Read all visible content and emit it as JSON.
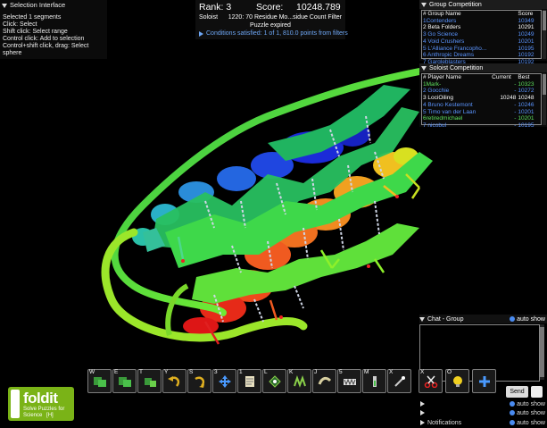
{
  "selection_panel": {
    "title": "Selection Interface",
    "lines": [
      "Selected 1 segments",
      "Click: Select",
      "Shift click: Select range",
      "Control click: Add to selection",
      "Control+shift click, drag: Select",
      "sphere"
    ]
  },
  "score": {
    "rank_label": "Rank: 3",
    "score_label": "Score:",
    "score_value": "10248.789",
    "mode": "Soloist",
    "puzzle": "1220: 70 Residue Mo...sidue Count Filter",
    "status": "Puzzle expired",
    "conditions": "Conditions satisfied: 1 of 1, 810.0 points from filters"
  },
  "group_competition": {
    "title": "Group Competition",
    "headers": [
      "# Group Name",
      "Score"
    ],
    "rows": [
      {
        "name": "1Contenders",
        "score": "10349"
      },
      {
        "name": "2 Beta Folders",
        "score": "10291"
      },
      {
        "name": "3 Go Science",
        "score": "10249"
      },
      {
        "name": "4 Void Crushers",
        "score": "10201"
      },
      {
        "name": "5 L'Alliance Francopho...",
        "score": "10195"
      },
      {
        "name": "6 Anthropic Dreams",
        "score": "10192"
      },
      {
        "name": "7 Gargleblasters",
        "score": "10192"
      }
    ]
  },
  "soloist_competition": {
    "title": "Soloist Competition",
    "headers": [
      "# Player Name",
      "Current",
      "Best"
    ],
    "rows": [
      {
        "name": "1Mark-",
        "current": "-",
        "best": "10323",
        "style": "green"
      },
      {
        "name": "2 Gocchie",
        "current": "-",
        "best": "10272",
        "style": "blue"
      },
      {
        "name": "3 LociOiling",
        "current": "10248",
        "best": "10248",
        "style": "white"
      },
      {
        "name": "4 Bruno Kestemont",
        "current": "-",
        "best": "10246",
        "style": "blue"
      },
      {
        "name": "5 Timo van der Laan",
        "current": "-",
        "best": "10201",
        "style": "blue"
      },
      {
        "name": "6retiredmichael",
        "current": "-",
        "best": "10201",
        "style": "green"
      },
      {
        "name": "7 nicobul",
        "current": "-",
        "best": "10195",
        "style": "blue"
      }
    ]
  },
  "chat": {
    "title": "Chat - Group",
    "auto_show": "auto show",
    "send_label": "Send"
  },
  "bottom_rows": [
    {
      "title": "",
      "auto_show": "auto show"
    },
    {
      "title": "",
      "auto_show": "auto show"
    },
    {
      "title": "Notifications",
      "auto_show": "auto show"
    }
  ],
  "logo": {
    "word": "foldit",
    "tagline": "Solve Puzzles for Science",
    "badge": "[H]"
  },
  "toolbar": {
    "keys": [
      "W",
      "E",
      "T",
      "Y",
      "S",
      "3",
      "1",
      "L",
      "K",
      "J",
      "5",
      "M",
      "X",
      "O",
      ""
    ],
    "icons": [
      "wiggle-all-icon",
      "wiggle-sidechains-icon",
      "tweak-icon",
      "undo-icon",
      "shake-icon",
      "move-icon",
      "notes-icon",
      "rebuild-icon",
      "mutate-icon",
      "cut-icon",
      "freeze-icon",
      "rubber-band-icon",
      "scissors-icon",
      "lightbulb-icon",
      "add-icon"
    ]
  },
  "colors": {
    "panel_bg": "#0a0a0a",
    "link_blue": "#5b95ff",
    "green_text": "#5ee05e",
    "logo_green": "#7ab317"
  }
}
